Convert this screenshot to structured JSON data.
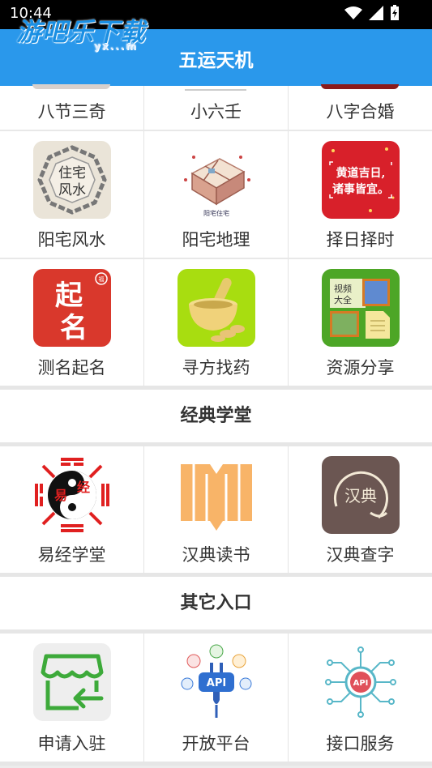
{
  "status": {
    "time": "10:44"
  },
  "watermark": {
    "text": "游吧乐下载",
    "sub": "yx...m"
  },
  "header": {
    "title": "五运天机"
  },
  "top_partial": [
    {
      "label": "八节三奇",
      "icon": "eight-nodes-icon"
    },
    {
      "label": "小六壬",
      "icon": "xiaoliuren-icon"
    },
    {
      "label": "八字合婚",
      "icon": "bazi-marriage-icon"
    }
  ],
  "grid1": [
    [
      {
        "label": "阳宅风水",
        "icon": "bagua-fengshui-icon",
        "glyph": "住宅\n风水"
      },
      {
        "label": "阳宅地理",
        "icon": "house-floorplan-icon",
        "glyph": "阳宅住宅"
      },
      {
        "label": "择日择时",
        "icon": "auspicious-day-icon",
        "glyph": "黄道吉日,\n诸事皆宜。"
      }
    ],
    [
      {
        "label": "测名起名",
        "icon": "naming-icon",
        "glyph": "起名"
      },
      {
        "label": "寻方找药",
        "icon": "mortar-pestle-icon",
        "glyph": ""
      },
      {
        "label": "资源分享",
        "icon": "resource-share-icon",
        "glyph": "视频\n大全"
      }
    ]
  ],
  "classics": {
    "title": "经典学堂",
    "items": [
      {
        "label": "易经学堂",
        "icon": "yinyang-bagua-icon",
        "glyph": "易经"
      },
      {
        "label": "汉典读书",
        "icon": "open-book-icon",
        "glyph": ""
      },
      {
        "label": "汉典查字",
        "icon": "handian-dictionary-icon",
        "glyph": "汉典"
      }
    ]
  },
  "others": {
    "title": "其它入口",
    "items": [
      {
        "label": "申请入驻",
        "icon": "store-apply-icon",
        "glyph": ""
      },
      {
        "label": "开放平台",
        "icon": "api-plug-icon",
        "glyph": "API"
      },
      {
        "label": "接口服务",
        "icon": "api-circuit-icon",
        "glyph": "API"
      }
    ]
  }
}
